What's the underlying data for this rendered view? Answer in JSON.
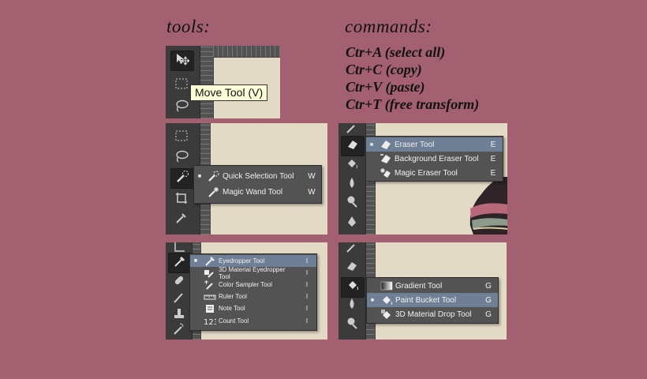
{
  "headings": {
    "tools": "tools:",
    "commands": "commands:"
  },
  "commands": [
    "Ctr+A (select all)",
    "Ctr+C (copy)",
    "Ctr+V (paste)",
    "Ctr+T (free transform)"
  ],
  "tooltip": "Move Tool (V)",
  "quick_selection_menu": [
    {
      "label": "Quick Selection Tool",
      "key": "W",
      "active": true,
      "icon": "quick-selection-icon"
    },
    {
      "label": "Magic Wand Tool",
      "key": "W",
      "active": false,
      "icon": "magic-wand-icon"
    }
  ],
  "eraser_menu": [
    {
      "label": "Eraser Tool",
      "key": "E",
      "active": true,
      "icon": "eraser-icon"
    },
    {
      "label": "Background Eraser Tool",
      "key": "E",
      "active": false,
      "icon": "background-eraser-icon"
    },
    {
      "label": "Magic Eraser Tool",
      "key": "E",
      "active": false,
      "icon": "magic-eraser-icon"
    }
  ],
  "eyedropper_menu": [
    {
      "label": "Eyedropper Tool",
      "key": "I",
      "active": true,
      "icon": "eyedropper-icon"
    },
    {
      "label": "3D Material Eyedropper Tool",
      "key": "I",
      "active": false,
      "icon": "3d-eyedropper-icon"
    },
    {
      "label": "Color Sampler Tool",
      "key": "I",
      "active": false,
      "icon": "color-sampler-icon"
    },
    {
      "label": "Ruler Tool",
      "key": "I",
      "active": false,
      "icon": "ruler-icon"
    },
    {
      "label": "Note Tool",
      "key": "I",
      "active": false,
      "icon": "note-icon"
    },
    {
      "label": "Count Tool",
      "key": "I",
      "active": false,
      "icon": "count-icon"
    }
  ],
  "paint_menu": [
    {
      "label": "Gradient Tool",
      "key": "G",
      "active": false,
      "icon": "gradient-icon"
    },
    {
      "label": "Paint Bucket Tool",
      "key": "G",
      "active": true,
      "icon": "paint-bucket-icon"
    },
    {
      "label": "3D Material Drop Tool",
      "key": "G",
      "active": false,
      "icon": "3d-material-drop-icon"
    }
  ],
  "colors": {
    "background": "#a26070",
    "toolbar": "#3b3b3b",
    "flyout": "#535353",
    "highlight": "#6f7f95",
    "canvas": "#e3dac5"
  }
}
